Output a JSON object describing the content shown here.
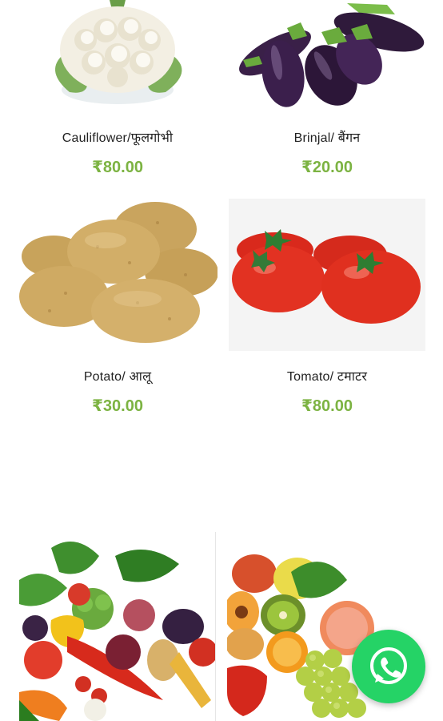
{
  "products": [
    {
      "name": "Cauliflower/फूलगोभी",
      "price": "₹80.00",
      "image_icon": "cauliflower-image"
    },
    {
      "name": "Brinjal/ बैंगन",
      "price": "₹20.00",
      "image_icon": "brinjal-image"
    },
    {
      "name": "Potato/ आलू",
      "price": "₹30.00",
      "image_icon": "potato-image"
    },
    {
      "name": "Tomato/ टमाटर",
      "price": "₹80.00",
      "image_icon": "tomato-image"
    }
  ],
  "category_tiles": [
    {
      "image_icon": "mixed-vegetables-image"
    },
    {
      "image_icon": "mixed-fruits-image"
    }
  ],
  "fab": {
    "icon": "whatsapp-icon",
    "color": "#25d366"
  },
  "colors": {
    "price": "#7cb342",
    "text": "#222222"
  }
}
